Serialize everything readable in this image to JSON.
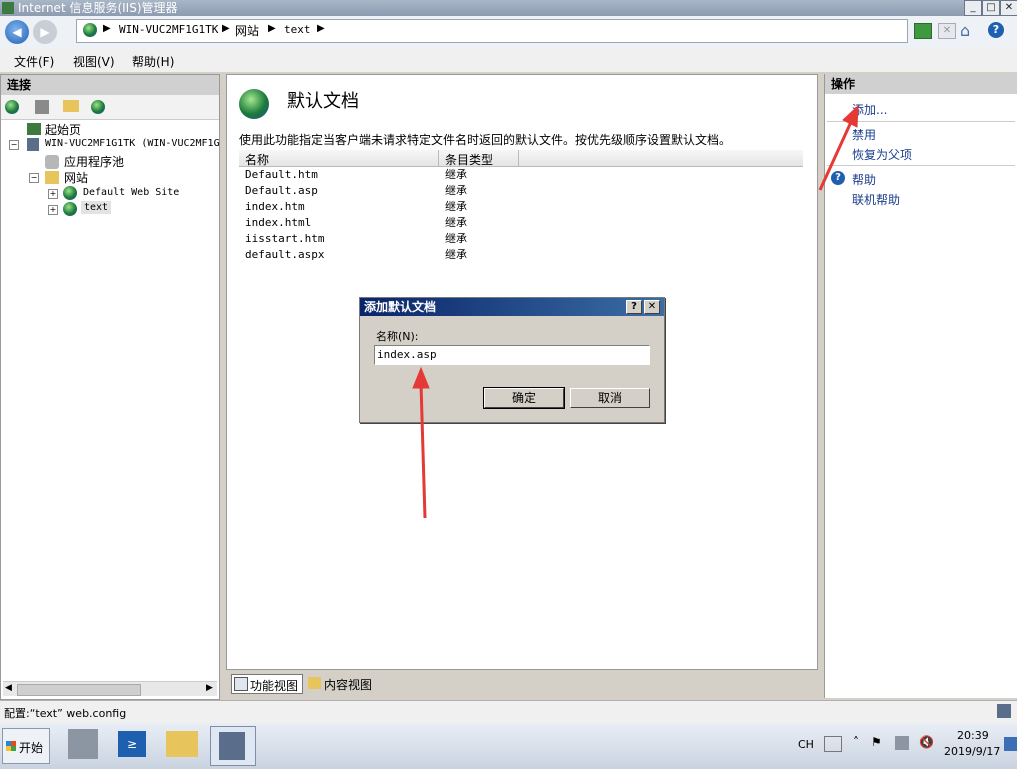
{
  "window": {
    "title": "Internet 信息服务(IIS)管理器"
  },
  "address": {
    "segments": [
      "WIN-VUC2MF1G1TK",
      "网站",
      "text"
    ]
  },
  "menu": {
    "items": [
      "文件(F)",
      "视图(V)",
      "帮助(H)"
    ]
  },
  "connections": {
    "header": "连接",
    "tree": {
      "start_page": "起始页",
      "server": "WIN-VUC2MF1G1TK (WIN-VUC2MF1G",
      "app_pools": "应用程序池",
      "sites": "网站",
      "site_default": "Default Web Site",
      "site_text": "text"
    }
  },
  "feature": {
    "title": "默认文档",
    "description": "使用此功能指定当客户端未请求特定文件名时返回的默认文件。按优先级顺序设置默认文档。",
    "columns": [
      "名称",
      "条目类型"
    ],
    "rows": [
      {
        "name": "Default.htm",
        "type": "继承"
      },
      {
        "name": "Default.asp",
        "type": "继承"
      },
      {
        "name": "index.htm",
        "type": "继承"
      },
      {
        "name": "index.html",
        "type": "继承"
      },
      {
        "name": "iisstart.htm",
        "type": "继承"
      },
      {
        "name": "default.aspx",
        "type": "继承"
      }
    ],
    "view_tabs": [
      "功能视图",
      "内容视图"
    ]
  },
  "actions": {
    "header": "操作",
    "add": "添加...",
    "disable": "禁用",
    "revert": "恢复为父项",
    "help": "帮助",
    "online_help": "联机帮助"
  },
  "dialog": {
    "title": "添加默认文档",
    "name_label": "名称(N):",
    "name_value": "index.asp",
    "ok": "确定",
    "cancel": "取消",
    "help_glyph": "?",
    "close_glyph": "✕"
  },
  "status": {
    "text": "配置:“text” web.config"
  },
  "taskbar": {
    "start": "开始",
    "lang": "CH",
    "time": "20:39",
    "date": "2019/9/17"
  },
  "colors": {
    "annotation_arrow": "#e53935",
    "dialog_title": "#0a246a"
  }
}
